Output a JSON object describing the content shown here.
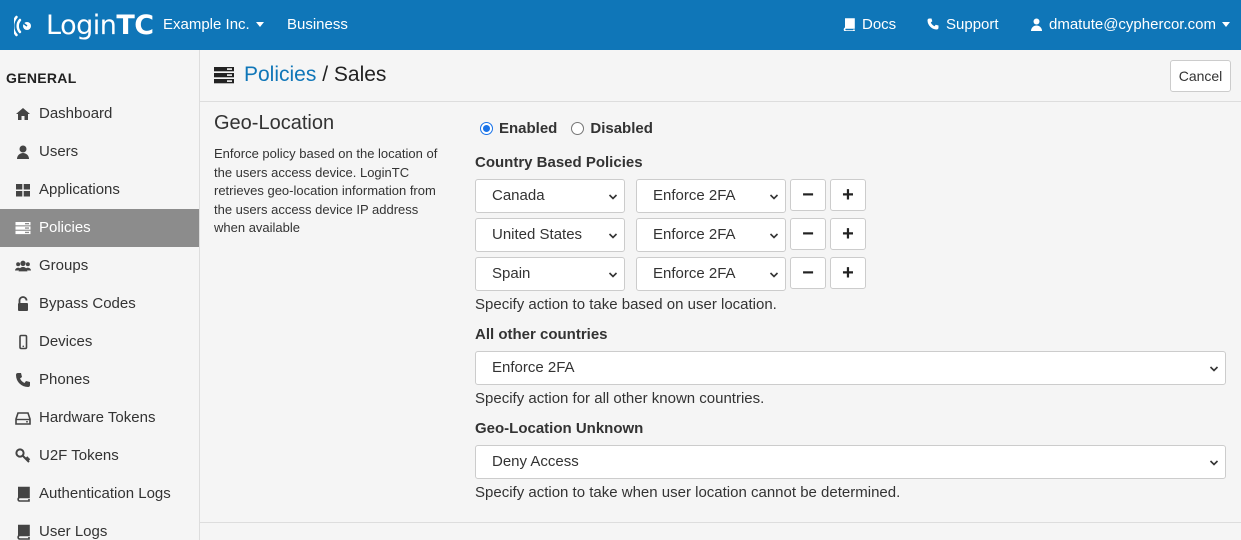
{
  "topbar": {
    "logo_text_light": "Login",
    "logo_text_bold": "TC",
    "org": "Example Inc.",
    "plan": "Business",
    "docs": "Docs",
    "support": "Support",
    "user": "dmatute@cyphercor.com",
    "colors": {
      "bar": "#0f76b8",
      "text": "#ffffff"
    }
  },
  "sidebar": {
    "heading": "GENERAL",
    "items": [
      {
        "label": "Dashboard",
        "icon": "home-icon"
      },
      {
        "label": "Users",
        "icon": "user-icon"
      },
      {
        "label": "Applications",
        "icon": "grid-icon"
      },
      {
        "label": "Policies",
        "icon": "server-icon",
        "active": true
      },
      {
        "label": "Groups",
        "icon": "users-icon"
      },
      {
        "label": "Bypass Codes",
        "icon": "lock-icon"
      },
      {
        "label": "Devices",
        "icon": "mobile-icon"
      },
      {
        "label": "Phones",
        "icon": "phone-icon"
      },
      {
        "label": "Hardware Tokens",
        "icon": "hdd-icon"
      },
      {
        "label": "U2F Tokens",
        "icon": "key-icon"
      },
      {
        "label": "Authentication Logs",
        "icon": "book-icon"
      },
      {
        "label": "User Logs",
        "icon": "book-icon"
      }
    ]
  },
  "header": {
    "breadcrumb_link": "Policies",
    "separator": " / ",
    "current": "Sales",
    "cancel_label": "Cancel"
  },
  "geo": {
    "title": "Geo-Location",
    "description": "Enforce policy based on the location of the users access device. LoginTC retrieves geo-location information from the users access device IP address when available",
    "enabled_label": "Enabled",
    "disabled_label": "Disabled",
    "state": "enabled",
    "country_policies_label": "Country Based Policies",
    "rows": [
      {
        "country": "Canada",
        "action": "Enforce 2FA"
      },
      {
        "country": "United States",
        "action": "Enforce 2FA"
      },
      {
        "country": "Spain",
        "action": "Enforce 2FA"
      }
    ],
    "remove_symbol": "−",
    "add_symbol": "+",
    "country_help": "Specify action to take based on user location.",
    "other_label": "All other countries",
    "other_value": "Enforce 2FA",
    "other_help": "Specify action for all other known countries.",
    "unknown_label": "Geo-Location Unknown",
    "unknown_value": "Deny Access",
    "unknown_help": "Specify action to take when user location cannot be determined."
  }
}
